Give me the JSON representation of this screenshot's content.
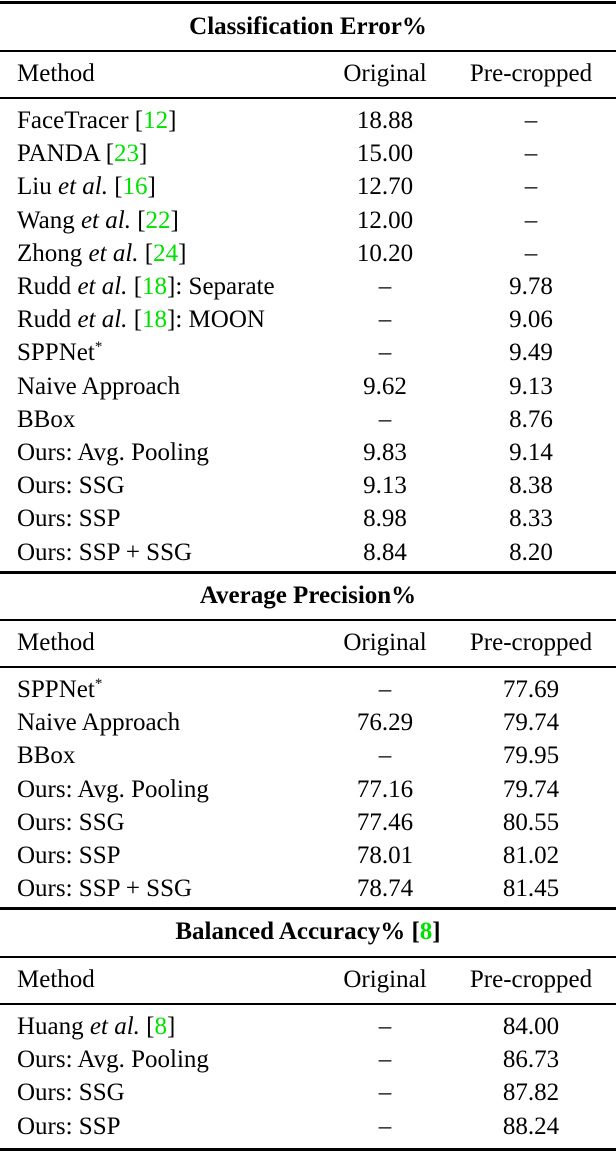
{
  "sections": [
    {
      "title": "Classification Error%",
      "columns": [
        "Method",
        "Original",
        "Pre-cropped"
      ],
      "rows": [
        {
          "pre": "FaceTracer ",
          "em": "",
          "cite": "12",
          "post": "",
          "original": "18.88",
          "precropped": "–"
        },
        {
          "pre": "PANDA ",
          "em": "",
          "cite": "23",
          "post": "",
          "original": "15.00",
          "precropped": "–"
        },
        {
          "pre": "Liu ",
          "em": "et al.",
          "cite": "16",
          "post": "",
          "original": "12.70",
          "precropped": "–"
        },
        {
          "pre": "Wang ",
          "em": "et al.",
          "cite": "22",
          "post": "",
          "original": "12.00",
          "precropped": "–"
        },
        {
          "pre": "Zhong ",
          "em": "et al.",
          "cite": "24",
          "post": "",
          "original": "10.20",
          "precropped": "–"
        },
        {
          "pre": "Rudd ",
          "em": "et al.",
          "cite": "18",
          "post": ": Separate",
          "original": "–",
          "precropped": "9.78"
        },
        {
          "pre": "Rudd ",
          "em": "et al.",
          "cite": "18",
          "post": ": MOON",
          "original": "–",
          "precropped": "9.06"
        },
        {
          "pre": "SPPNet",
          "sup": "*",
          "original": "–",
          "precropped": "9.49"
        },
        {
          "pre": "Naive Approach",
          "original": "9.62",
          "precropped": "9.13"
        },
        {
          "pre": "BBox",
          "original": "–",
          "precropped": "8.76"
        },
        {
          "pre": "Ours: Avg. Pooling",
          "original": "9.83",
          "precropped": "9.14"
        },
        {
          "pre": "Ours: SSG",
          "original": "9.13",
          "precropped": "8.38"
        },
        {
          "pre": "Ours: SSP",
          "original": "8.98",
          "precropped": "8.33"
        },
        {
          "pre": "Ours: SSP + SSG",
          "original": "8.84",
          "precropped": "8.20"
        }
      ]
    },
    {
      "title": "Average Precision%",
      "columns": [
        "Method",
        "Original",
        "Pre-cropped"
      ],
      "rows": [
        {
          "pre": "SPPNet",
          "sup": "*",
          "original": "–",
          "precropped": "77.69"
        },
        {
          "pre": "Naive Approach",
          "original": "76.29",
          "precropped": "79.74"
        },
        {
          "pre": "BBox",
          "original": "–",
          "precropped": "79.95"
        },
        {
          "pre": "Ours: Avg. Pooling",
          "original": "77.16",
          "precropped": "79.74"
        },
        {
          "pre": "Ours: SSG",
          "original": "77.46",
          "precropped": "80.55"
        },
        {
          "pre": "Ours: SSP",
          "original": "78.01",
          "precropped": "81.02"
        },
        {
          "pre": "Ours: SSP + SSG",
          "original": "78.74",
          "precropped": "81.45"
        }
      ]
    },
    {
      "title": "Balanced Accuracy% ",
      "title_cite": "8",
      "columns": [
        "Method",
        "Original",
        "Pre-cropped"
      ],
      "rows": [
        {
          "pre": "Huang ",
          "em": "et al.",
          "cite": "8",
          "post": "",
          "original": "–",
          "precropped": "84.00"
        },
        {
          "pre": "Ours: Avg. Pooling",
          "original": "–",
          "precropped": "86.73"
        },
        {
          "pre": "Ours: SSG",
          "original": "–",
          "precropped": "87.82"
        },
        {
          "pre": "Ours: SSP",
          "original": "–",
          "precropped": "88.24"
        }
      ]
    }
  ],
  "colors": {
    "citation": "#00e000",
    "text": "#000000",
    "rule": "#000000"
  }
}
